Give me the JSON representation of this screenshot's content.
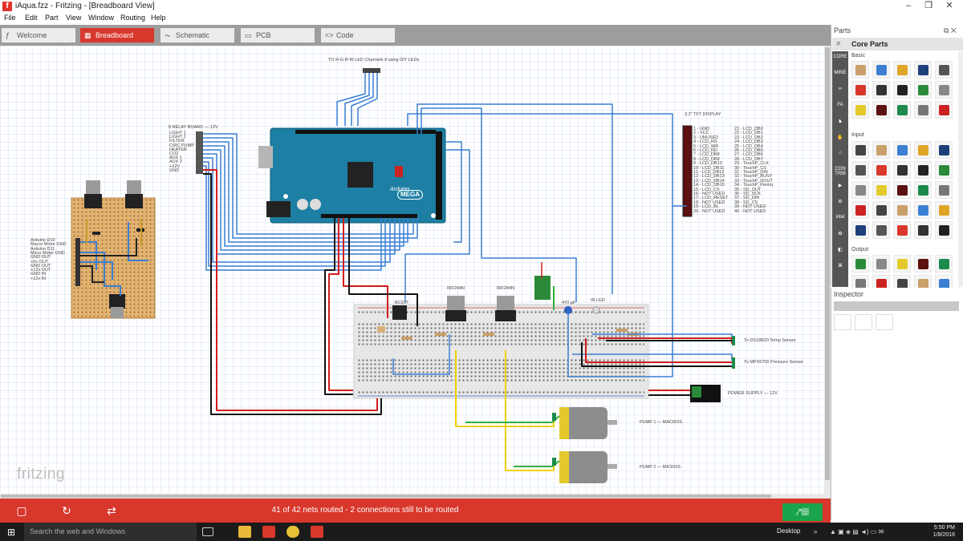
{
  "window": {
    "title": "iAqua.fzz - Fritzing - [Breadboard View]",
    "app_icon": "fritzing-f-icon"
  },
  "window_controls": [
    "minimize",
    "maximize",
    "close"
  ],
  "menu": [
    "File",
    "Edit",
    "Part",
    "View",
    "Window",
    "Routing",
    "Help"
  ],
  "tabs": [
    {
      "label": "Welcome",
      "icon": "welcome-icon"
    },
    {
      "label": "Breadboard",
      "icon": "breadboard-icon",
      "active": true
    },
    {
      "label": "Schematic",
      "icon": "schematic-icon"
    },
    {
      "label": "PCB",
      "icon": "pcb-icon"
    },
    {
      "label": "Code",
      "icon": "code-icon"
    }
  ],
  "canvas": {
    "watermark": "fritzing",
    "labels": {
      "rgbw": "TO R-G-B-W LED Channels if using DIY LEDs",
      "relay_title": "8 RELAY BOARD — 12V",
      "relay_pins": [
        "LIGHT 1",
        "LIGHT 2",
        "FILTER",
        "CIRC PUMP",
        "HEATER",
        "CO2",
        "AUX 1",
        "AUX 2",
        "+12V",
        "GND"
      ],
      "motor_lines": [
        "Arduino D10",
        "Macro Motor GND",
        "Arduino D11",
        "Micro Motor GND",
        "GND OUT",
        "+5v OUT",
        "GND OUT",
        "+12v OUT",
        "GND IN",
        "+12v IN"
      ],
      "tft_title": "3.2\" TFT DISPLAY",
      "tft_left": [
        "1 - GND",
        "2 - VCC",
        "3 - UNUSED",
        "4 - LCD_RS",
        "5 - LCD_WR",
        "6 - LCD_RD",
        "7 - LCD_DB8",
        "8 - LCD_DB9",
        "9 - LCD_DB10",
        "10 - LCD_DB11",
        "11 - LCD_DB12",
        "12 - LCD_DB13",
        "13 - LCD_DB14",
        "14 - LCD_DB15",
        "15 - LCD_CS",
        "16 - NOT USED",
        "17 - LCD_RESET",
        "18 - NOT USED",
        "19 - LCD_BL",
        "20 - NOT USED"
      ],
      "tft_right": [
        "21 - LCD_DB0",
        "22 - LCD_DB1",
        "23 - LCD_DB2",
        "24 - LCD_DB3",
        "25 - LCD_DB4",
        "26 - LCD_DB5",
        "27 - LCD_DB6",
        "28 - LCD_DB7",
        "29 - TouchP_CLK",
        "30 - TouchP_CS",
        "31 - TouchP_DIN",
        "32 - TouchP_BUSY",
        "33 - TouchP_DOUT",
        "34 - TouchP_Penirq",
        "35 - SD_OUT",
        "36 - SD_SCK",
        "37 - SD_DIN",
        "38 - SD_CS",
        "39 - NOT USED",
        "40 - NOT USED"
      ],
      "bc337": "BC337",
      "irf1": "IRF244N",
      "irf2": "IRF244N",
      "cap": "470 µF",
      "irled": "IR LED",
      "ds18b20": "To DS18B20 Temp Sensor",
      "mpx": "To MPX5700 Pressure Sensor",
      "power": "POWER SUPPLY — 12V",
      "pump1": "PUMP 1 — MACROS",
      "pump2": "PUMP 2 — MICROS",
      "arduino_brand": "Arduino",
      "arduino_model": "MEGA"
    }
  },
  "status": {
    "text": "41 of 42 nets routed - 2 connections still to be routed"
  },
  "bottom_tools": [
    "add-icon",
    "rotate-icon",
    "flip-icon"
  ],
  "autoroute": {
    "icon": "autoroute-icon"
  },
  "parts": {
    "header": "Parts",
    "search_label": "Core Parts",
    "bins": [
      "CORE",
      "MINE",
      "∞",
      "FA",
      "♞",
      "✋",
      "⌂",
      "CON TRIB",
      "▶",
      "⚙",
      "intel",
      "✿",
      "◧",
      "⌘"
    ],
    "sections": [
      "Basic",
      "Input",
      "Output"
    ]
  },
  "inspector": {
    "header": "Inspector"
  },
  "taskbar": {
    "search_placeholder": "Search the web and Windows",
    "desktop_label": "Desktop",
    "time": "5:50 PM",
    "date": "1/8/2016"
  },
  "colors": {
    "accent": "#d8372c",
    "routing_green": "#19a34a",
    "wire_blue": "#3b7fd3",
    "wire_red": "#d41c1c",
    "arduino": "#1d7fa3"
  }
}
